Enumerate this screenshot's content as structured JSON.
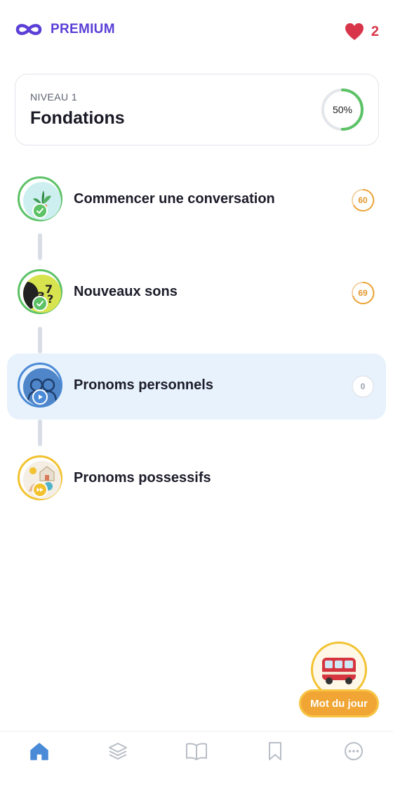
{
  "header": {
    "premium_label": "PREMIUM",
    "premium_icon": "infinity-icon",
    "hearts_count": "2",
    "hearts_icon": "heart-icon"
  },
  "level": {
    "label": "NIVEAU 1",
    "title": "Fondations",
    "progress_text": "50%",
    "progress_fraction": 0.5
  },
  "lessons": [
    {
      "title": "Commencer une conversation",
      "score": "60",
      "status": "completed",
      "status_icon": "check-icon"
    },
    {
      "title": "Nouveaux sons",
      "score": "69",
      "status": "completed",
      "status_icon": "check-icon"
    },
    {
      "title": "Pronoms personnels",
      "score": "0",
      "status": "current",
      "status_icon": "play-icon"
    },
    {
      "title": "Pronoms possessifs",
      "score": "",
      "status": "locked",
      "status_icon": "fast-forward-icon"
    }
  ],
  "word_of_day": {
    "label": "Mot du jour",
    "icon": "bus-icon"
  },
  "nav": [
    "home-icon",
    "layers-icon",
    "book-icon",
    "bookmark-icon",
    "more-icon"
  ],
  "colors": {
    "brand_purple": "#5b3fd6",
    "heart_red": "#d8354a",
    "success_green": "#5cc266",
    "active_blue": "#4a8ad6",
    "highlight_bg": "#e7f2fd",
    "gold": "#f2c230",
    "orange": "#f0a534"
  }
}
